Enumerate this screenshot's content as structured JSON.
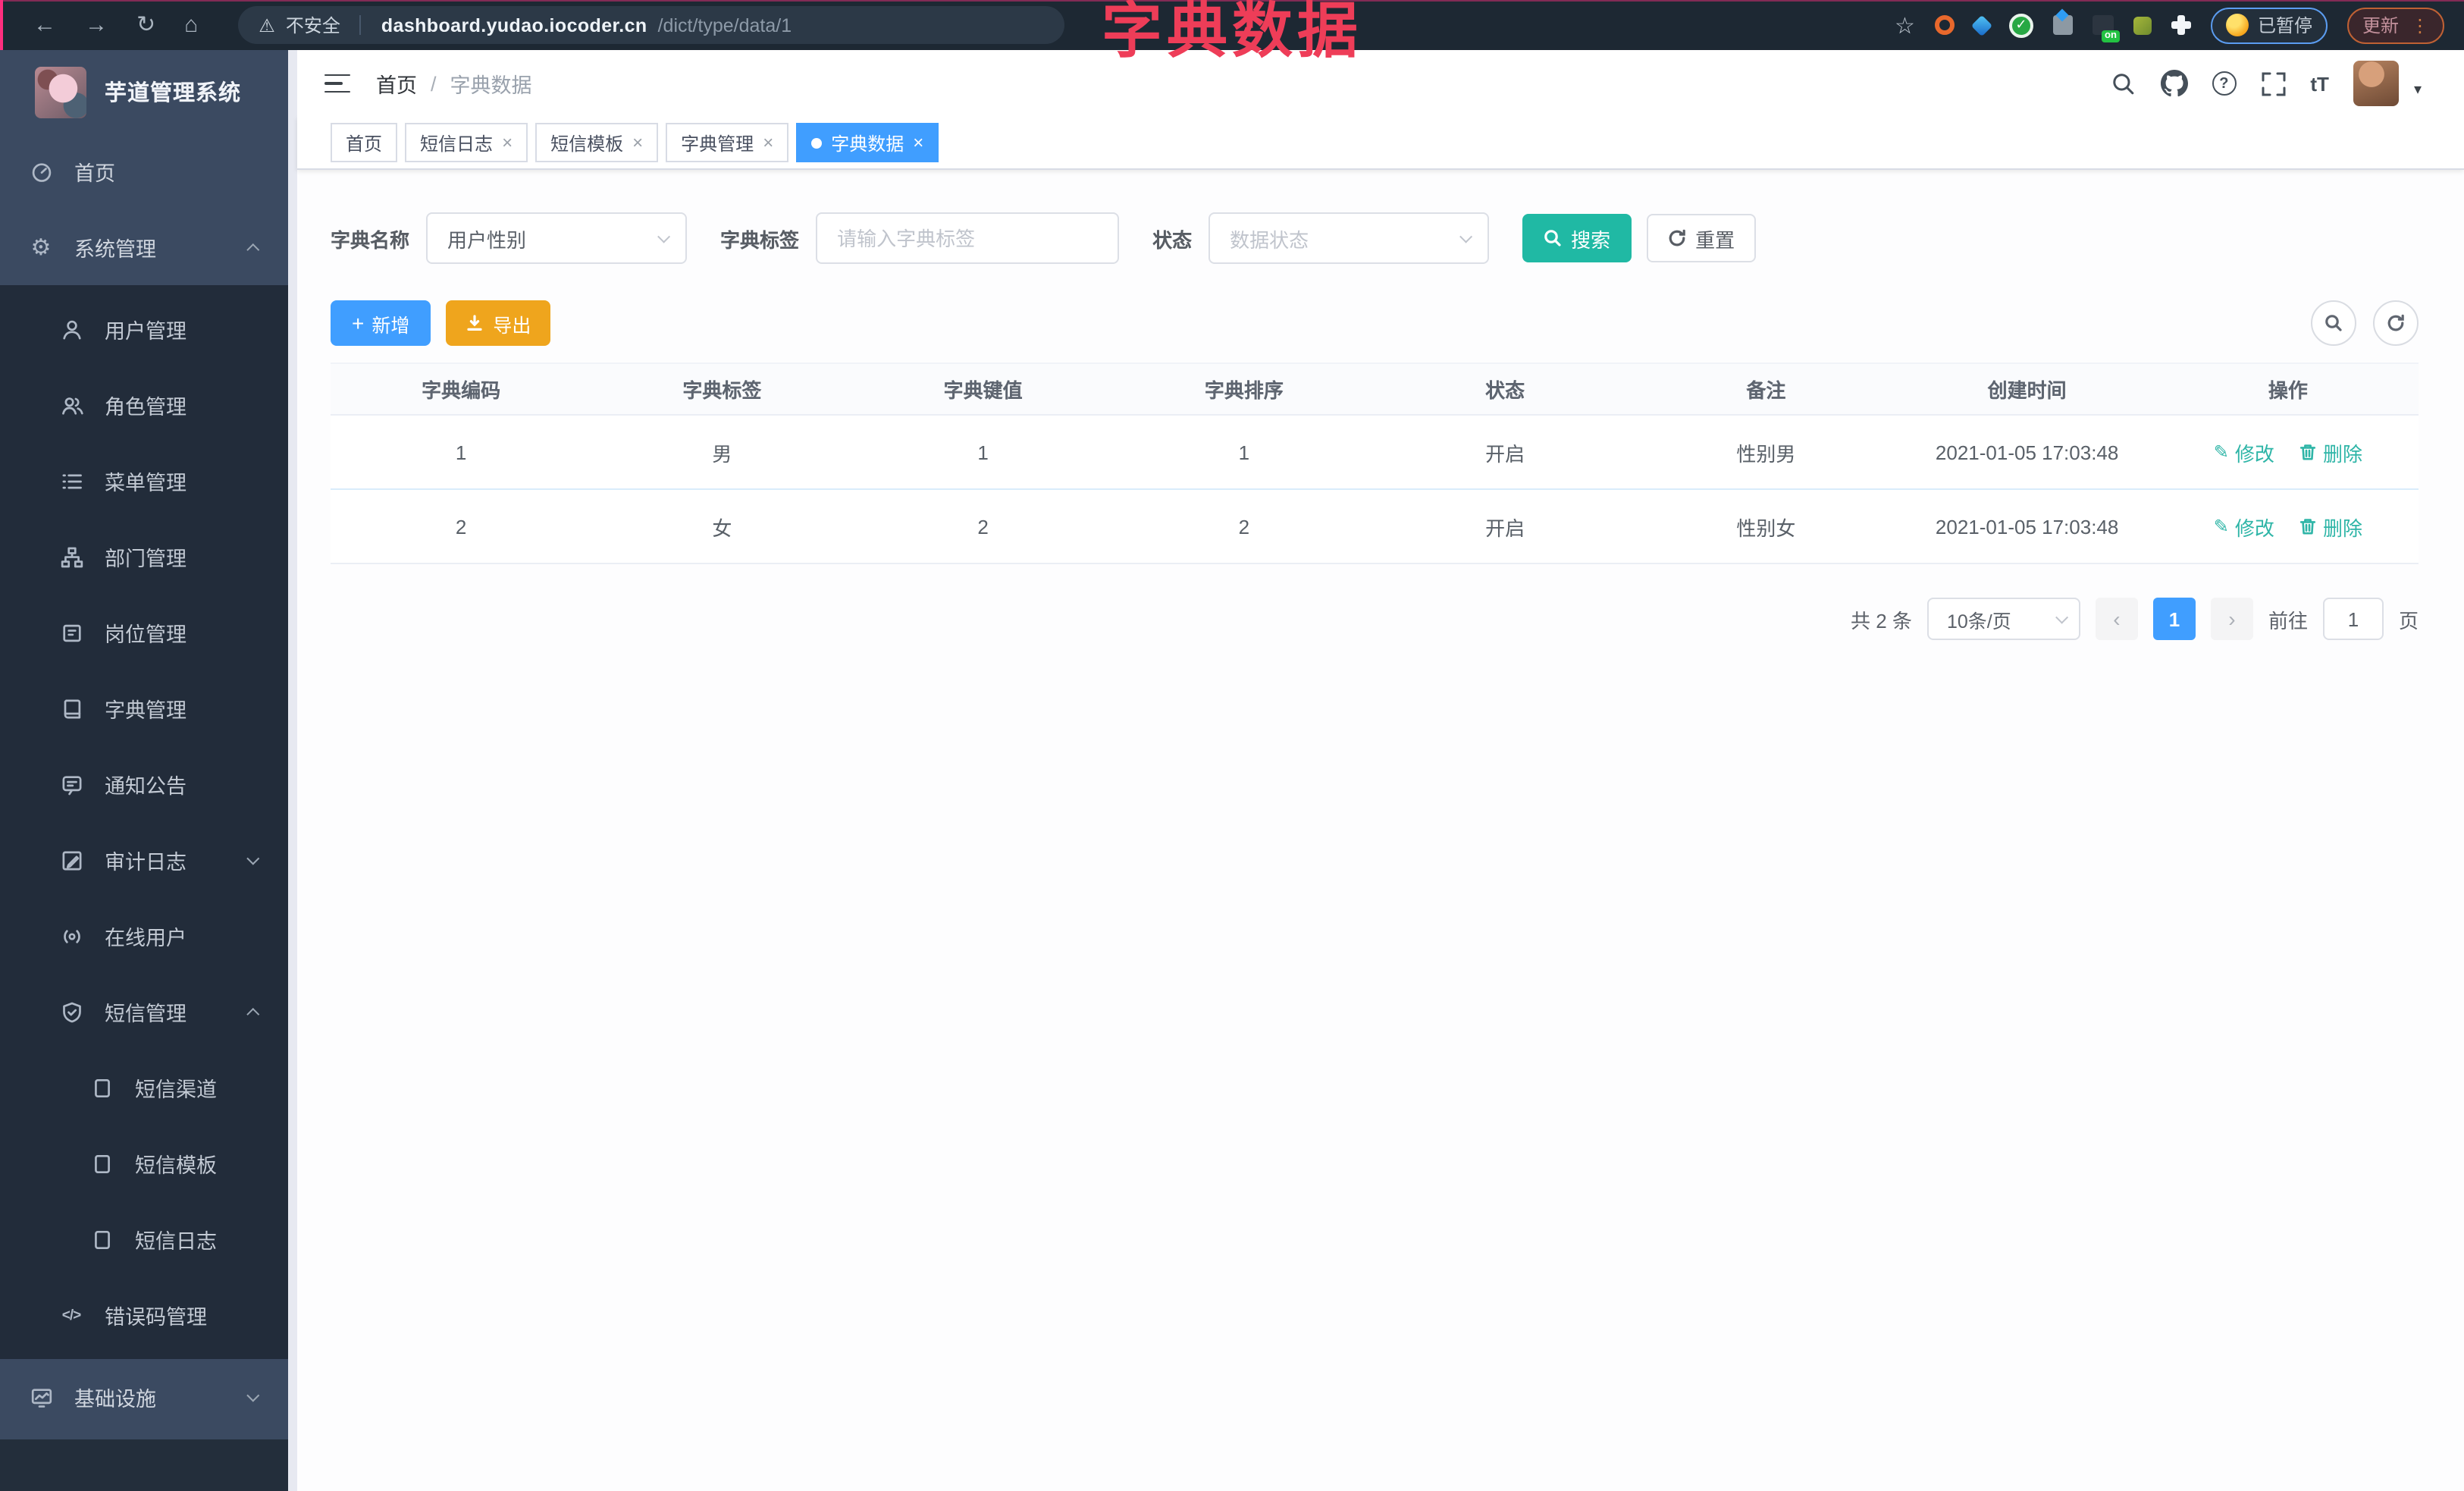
{
  "overlay_title": "字典数据",
  "chrome": {
    "security_label": "不安全",
    "url_host": "dashboard.yudao.iocoder.cn",
    "url_path": "/dict/type/data/1",
    "ext_on_badge": "on",
    "paused_badge": "已暂停",
    "update_button": "更新"
  },
  "glyphs": {
    "back": "←",
    "forward": "→",
    "reload": "↻",
    "home": "⌂",
    "warning": "⚠",
    "star": "☆",
    "kebab": "⋮",
    "check": "✓",
    "close": "×",
    "plus": "+",
    "caret_down": "▾",
    "question": "?",
    "font_size": "tT",
    "gear": "⚙",
    "code": "</>",
    "edit_pencil": "✎",
    "prev": "‹",
    "next": "›",
    "crumb_sep": "/"
  },
  "sidebar": {
    "app_title": "芋道管理系统",
    "items": [
      {
        "label": "首页"
      },
      {
        "label": "系统管理"
      },
      {
        "label": "用户管理"
      },
      {
        "label": "角色管理"
      },
      {
        "label": "菜单管理"
      },
      {
        "label": "部门管理"
      },
      {
        "label": "岗位管理"
      },
      {
        "label": "字典管理"
      },
      {
        "label": "通知公告"
      },
      {
        "label": "审计日志"
      },
      {
        "label": "在线用户"
      },
      {
        "label": "短信管理"
      },
      {
        "label": "短信渠道"
      },
      {
        "label": "短信模板"
      },
      {
        "label": "短信日志"
      },
      {
        "label": "错误码管理"
      },
      {
        "label": "基础设施"
      }
    ]
  },
  "header": {
    "breadcrumb_home": "首页",
    "breadcrumb_current": "字典数据"
  },
  "tabs": [
    {
      "label": "首页"
    },
    {
      "label": "短信日志"
    },
    {
      "label": "短信模板"
    },
    {
      "label": "字典管理"
    },
    {
      "label": "字典数据"
    }
  ],
  "filters": {
    "name_label": "字典名称",
    "name_value": "用户性别",
    "tag_label": "字典标签",
    "tag_placeholder": "请输入字典标签",
    "status_label": "状态",
    "status_placeholder": "数据状态",
    "search_button": "搜索",
    "reset_button": "重置"
  },
  "toolbar": {
    "add_button": "新增",
    "export_button": "导出"
  },
  "table": {
    "headers": [
      "字典编码",
      "字典标签",
      "字典键值",
      "字典排序",
      "状态",
      "备注",
      "创建时间",
      "操作"
    ],
    "rows": [
      {
        "code": "1",
        "label": "男",
        "value": "1",
        "sort": "1",
        "status": "开启",
        "remark": "性别男",
        "created": "2021-01-05 17:03:48"
      },
      {
        "code": "2",
        "label": "女",
        "value": "2",
        "sort": "2",
        "status": "开启",
        "remark": "性别女",
        "created": "2021-01-05 17:03:48"
      }
    ],
    "edit_label": "修改",
    "delete_label": "删除"
  },
  "pagination": {
    "total_text": "共 2 条",
    "page_size": "10条/页",
    "current_page": "1",
    "goto_label": "前往",
    "goto_value": "1",
    "page_unit": "页"
  },
  "colors": {
    "primary_blue": "#409eff",
    "search_teal": "#20b9a4",
    "export_amber": "#efa51d",
    "link_teal": "#2eb5a7",
    "overlay_red": "#ee3d58",
    "sidebar_bg": "#3b4a61",
    "submenu_bg": "#222c3a",
    "chrome_bg": "#1d2833"
  }
}
